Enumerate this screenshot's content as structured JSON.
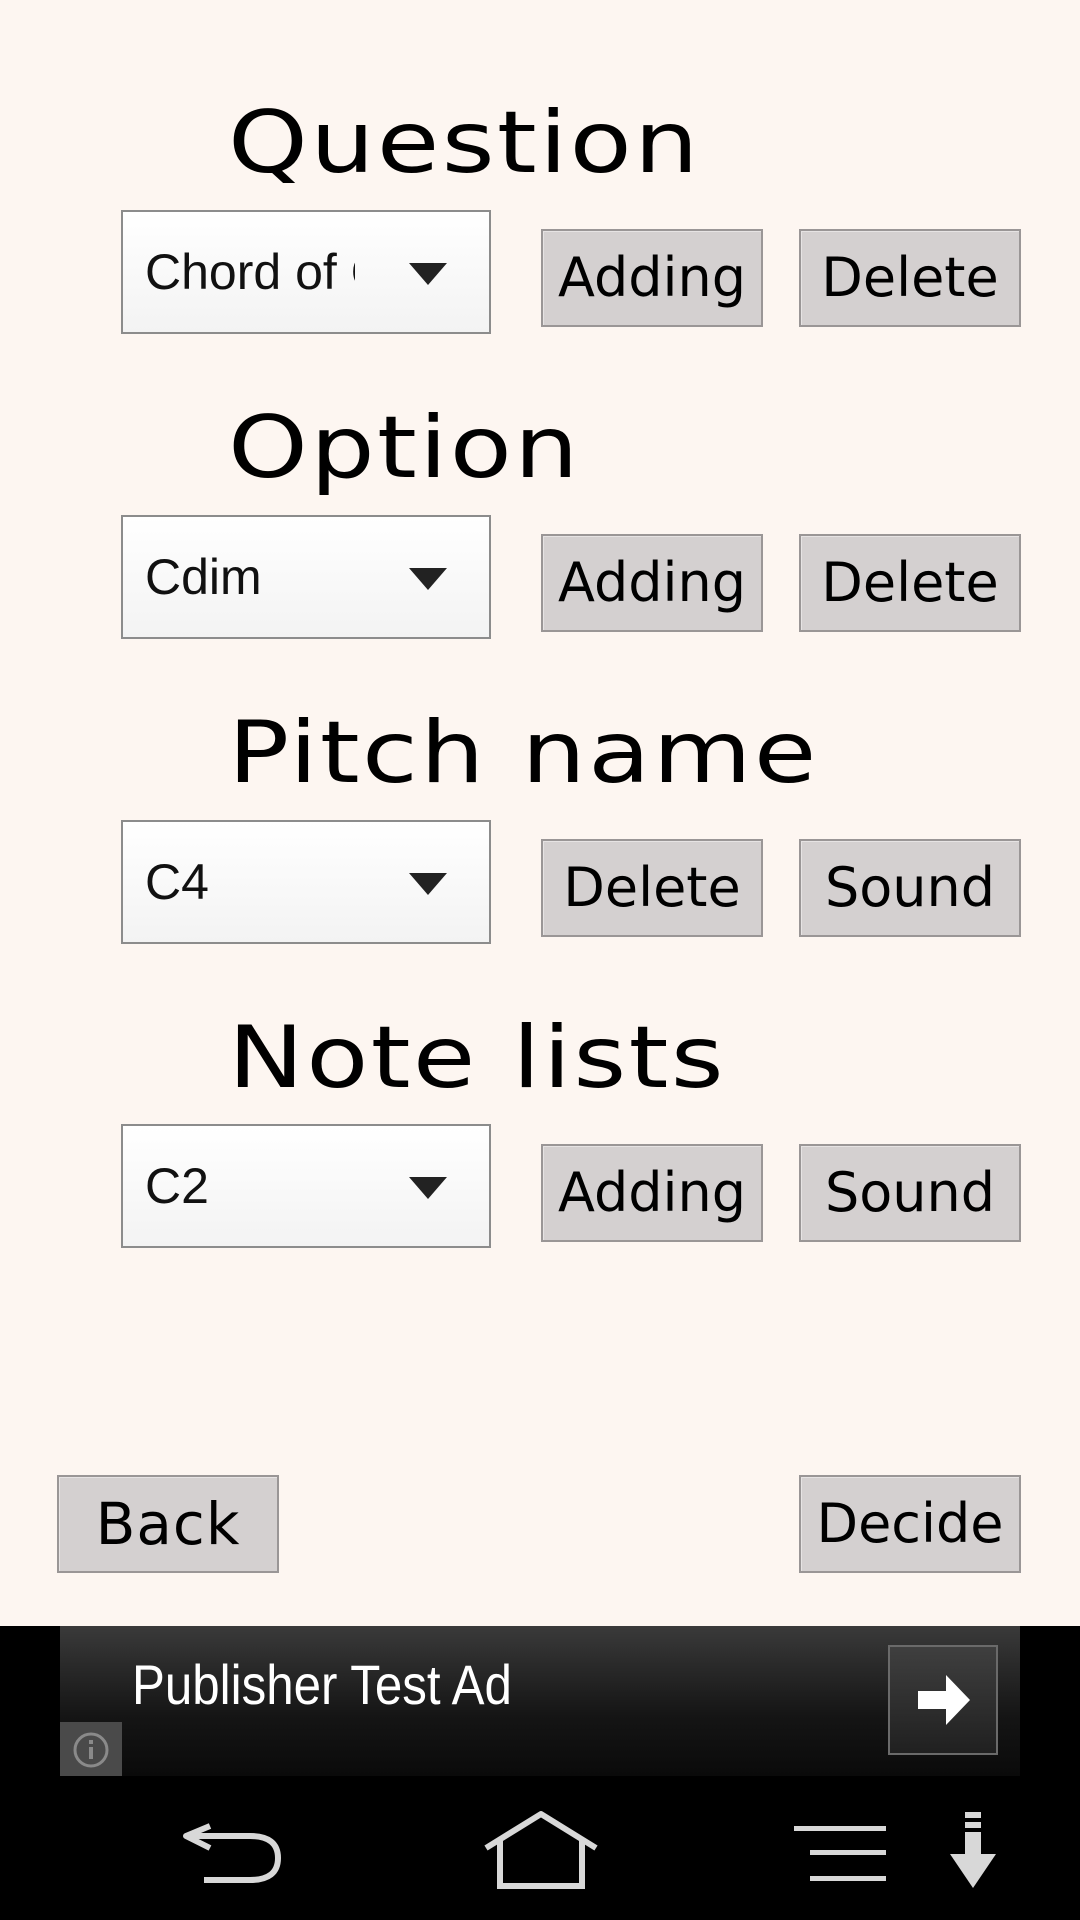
{
  "sections": {
    "question": {
      "title": "Question",
      "selected": "Chord of C",
      "button1": "Adding",
      "button2": "Delete"
    },
    "option": {
      "title": "Option",
      "selected": "Cdim",
      "button1": "Adding",
      "button2": "Delete"
    },
    "pitch_name": {
      "title": "Pitch name",
      "selected": "C4",
      "button1": "Delete",
      "button2": "Sound"
    },
    "note_lists": {
      "title": "Note lists",
      "selected": "C2",
      "button1": "Adding",
      "button2": "Sound"
    }
  },
  "footer": {
    "back_label": "Back",
    "decide_label": "Decide"
  },
  "ad": {
    "text": "Publisher Test Ad",
    "arrow_icon": "arrow-right-icon",
    "info_icon": "info-icon"
  },
  "system_nav": {
    "icons": [
      "back-icon",
      "home-icon",
      "menu-icon",
      "download-icon"
    ]
  }
}
